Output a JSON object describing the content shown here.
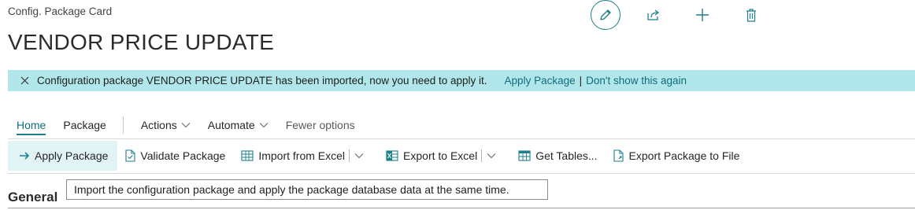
{
  "header": {
    "breadcrumb": "Config. Package Card",
    "title": "VENDOR PRICE UPDATE",
    "icons": [
      "edit-icon",
      "share-icon",
      "add-icon",
      "delete-icon"
    ]
  },
  "notification": {
    "message": "Configuration package VENDOR PRICE UPDATE has been imported, now you need to apply it.",
    "primary_link": "Apply Package",
    "separator": "|",
    "secondary_link": "Don't show this again"
  },
  "menu": {
    "home": "Home",
    "package": "Package",
    "actions": "Actions",
    "automate": "Automate",
    "fewer_options": "Fewer options"
  },
  "actions": {
    "apply_package": "Apply Package",
    "validate_package": "Validate Package",
    "import_from_excel": "Import from Excel",
    "export_to_excel": "Export to Excel",
    "get_tables": "Get Tables...",
    "export_package_to_file": "Export Package to File"
  },
  "section": {
    "general": "General"
  },
  "tooltip": {
    "text": "Import the configuration package and apply the package database data at the same time."
  },
  "colors": {
    "accent": "#1f7f8b",
    "notification_bg": "#b1e7ea",
    "highlight_bg": "#e1f3f5"
  }
}
